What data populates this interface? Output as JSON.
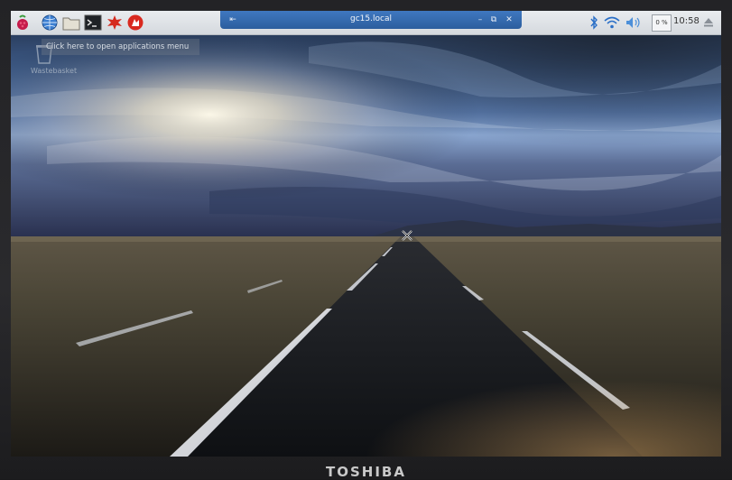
{
  "taskbar": {
    "launchers": [
      {
        "icon": "raspberry-menu-icon"
      },
      {
        "icon": "web-browser-globe-icon"
      },
      {
        "icon": "file-manager-folder-icon"
      },
      {
        "icon": "terminal-icon"
      },
      {
        "icon": "math-kernel-icon"
      },
      {
        "icon": "wolfram-icon"
      }
    ],
    "window_button": {
      "title": "gc15.local"
    },
    "tray": {
      "bluetooth_icon": "bluetooth-icon",
      "wifi_icon": "wifi-icon",
      "volume_icon": "volume-icon",
      "cpu_usage": "0 %",
      "clock": "10:58",
      "eject_icon": "eject-icon"
    }
  },
  "tooltip": {
    "text": "Click here to open applications menu"
  },
  "desktop": {
    "icons": [
      {
        "label": "Wastebasket",
        "icon": "wastebasket-icon"
      }
    ]
  },
  "bezel": {
    "brand": "TOSHIBA"
  },
  "colors": {
    "taskbar_bg": "#dfe3e7",
    "title_blue": "#3a6fb3",
    "sky_top": "#22324f",
    "horizon_glow": "#f5f3ea",
    "road": "#121518"
  }
}
